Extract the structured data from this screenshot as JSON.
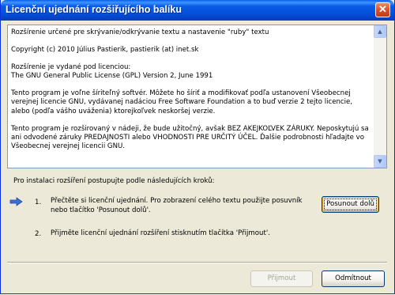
{
  "window": {
    "title": "Licenční ujednání rozšiřujícího balíku",
    "close_glyph": "✕"
  },
  "license": {
    "paragraphs": [
      "Rozšírenie určené pre skrývanie/odkrývanie textu a nastavenie \"ruby\" textu",
      "Copyright (c) 2010 Július Pastierik, pastierik (at) inet.sk",
      "Rozšírenie je vydané pod licenciou:\nThe GNU General Public License (GPL) Version 2, June 1991",
      "Tento program je voľne šíriteľný softvér. Môžete ho šíriť a modifikovať podľa ustanovení Všeobecnej verejnej licencie GNU, vydávanej nadáciou Free Software Foundation a to buď verzie 2 tejto licencie, alebo (podľa vášho uváženia) ktorejkoľvek neskoršej verzie.",
      "Tento program je rozširovaný v nádeji, že bude užitočný, avšak BEZ AKEJKOĽVEK ZÁRUKY. Neposkytujú sa ani odvodené záruky PREDAJNOSTI alebo VHODNOSTI PRE URČITÝ ÚČEL. Ďalšie podrobnosti hľadajte vo Všeobecnej verejnej licencii GNU."
    ]
  },
  "instructions": {
    "label": "Pro instalaci rozšíření postupujte podle následujících kroků:",
    "steps": [
      {
        "number": "1.",
        "text": "Přečtěte si licenční ujednání. Pro zobrazení celého textu použijte posuvník nebo tlačítko 'Posunout dolů'."
      },
      {
        "number": "2.",
        "text": "Přijměte licenční ujednání rozšíření stisknutím tlačítka 'Přijmout'."
      }
    ],
    "current_step_icon": "arrow-right-icon"
  },
  "buttons": {
    "scroll_down": "Posunout dolů",
    "accept": "Přijmout",
    "cancel": "Odmítnout"
  },
  "colors": {
    "titlebar": "#0453de",
    "dialog_background": "#ece9d8",
    "arrow_icon": "#3b6fd4"
  }
}
